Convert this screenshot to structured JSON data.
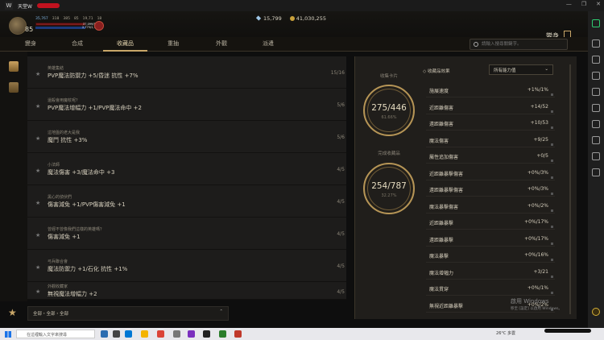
{
  "window": {
    "title": "天堂W"
  },
  "hud": {
    "level": "85",
    "stats": [
      "35,767",
      "318",
      "385",
      "85",
      "19,71",
      "18"
    ],
    "hp_text": "37,099/51,891",
    "mp_text": "2,773/2,773",
    "diamond": "15,799",
    "gold": "41,030,255",
    "page_title": "變身"
  },
  "tabs": [
    "變身",
    "合成",
    "收藏品",
    "重抽",
    "外觀",
    "派遣"
  ],
  "active_tab": "收藏品",
  "search": {
    "placeholder": "請輸入搜尋關鍵字。"
  },
  "collections": [
    {
      "category": "英雄集結",
      "desc": "PVP魔法防禦力 +5/昏迷 抗性 +7%",
      "progress": "15/16"
    },
    {
      "category": "還殺會用魔杖呢？",
      "desc": "PVP魔法增幅力 +1/PVP魔法命中 +2",
      "progress": "5/6"
    },
    {
      "category": "這地盤的老大是我",
      "desc": "魔鬥 抗性 +3%",
      "progress": "5/6"
    },
    {
      "category": "小法師",
      "desc": "魔法傷害 +3/魔法命中 +3",
      "progress": "4/5"
    },
    {
      "category": "黑心的偵伏們",
      "desc": "傷害減免 +1/PVP傷害減免 +1",
      "progress": "4/5"
    },
    {
      "category": "曾經不曾像我們這樣的英雄嗎？",
      "desc": "傷害減免 +1",
      "progress": "4/5"
    },
    {
      "category": "弓兵聯合會",
      "desc": "魔法防禦力 +1/石化 抗性 +1%",
      "progress": "4/5"
    },
    {
      "category": "外觀收藏家",
      "desc": "無視魔法增幅力 +2",
      "progress": "4/5"
    }
  ],
  "filter": {
    "label": "全部・全部・全部",
    "caret": "⌃"
  },
  "summary": {
    "card_label": "收集卡片",
    "card_value": "275/446",
    "card_pct": "61.66%",
    "done_label": "完成收藏品",
    "done_value": "254/787",
    "done_pct": "32.27%"
  },
  "effects_header": "◇ 收藏品效果",
  "effects_dropdown": "所有能力值",
  "effects": [
    {
      "name": "施展速度",
      "value": "+1%/1%"
    },
    {
      "name": "近距離傷害",
      "value": "+14/52"
    },
    {
      "name": "遠距離傷害",
      "value": "+10/53"
    },
    {
      "name": "魔法傷害",
      "value": "+9/25"
    },
    {
      "name": "屬性追加傷害",
      "value": "+0/5"
    },
    {
      "name": "近距離暴擊傷害",
      "value": "+0%/3%"
    },
    {
      "name": "遠距離暴擊傷害",
      "value": "+0%/3%"
    },
    {
      "name": "魔法暴擊傷害",
      "value": "+0%/2%"
    },
    {
      "name": "近距離暴擊",
      "value": "+0%/17%"
    },
    {
      "name": "遠距離暴擊",
      "value": "+0%/17%"
    },
    {
      "name": "魔法暴擊",
      "value": "+0%/16%"
    },
    {
      "name": "魔法增幅力",
      "value": "+3/21"
    },
    {
      "name": "魔法貫穿",
      "value": "+0%/1%"
    },
    {
      "name": "無視近距離暴擊",
      "value": "+0%/2%"
    }
  ],
  "watermark": {
    "line1": "啟用 Windows",
    "line2": "移至 [設定] 以啟用 Windows。"
  },
  "taskbar": {
    "search_placeholder": "在這裡輸入文字來搜尋",
    "tray": "26°C 多雲"
  }
}
